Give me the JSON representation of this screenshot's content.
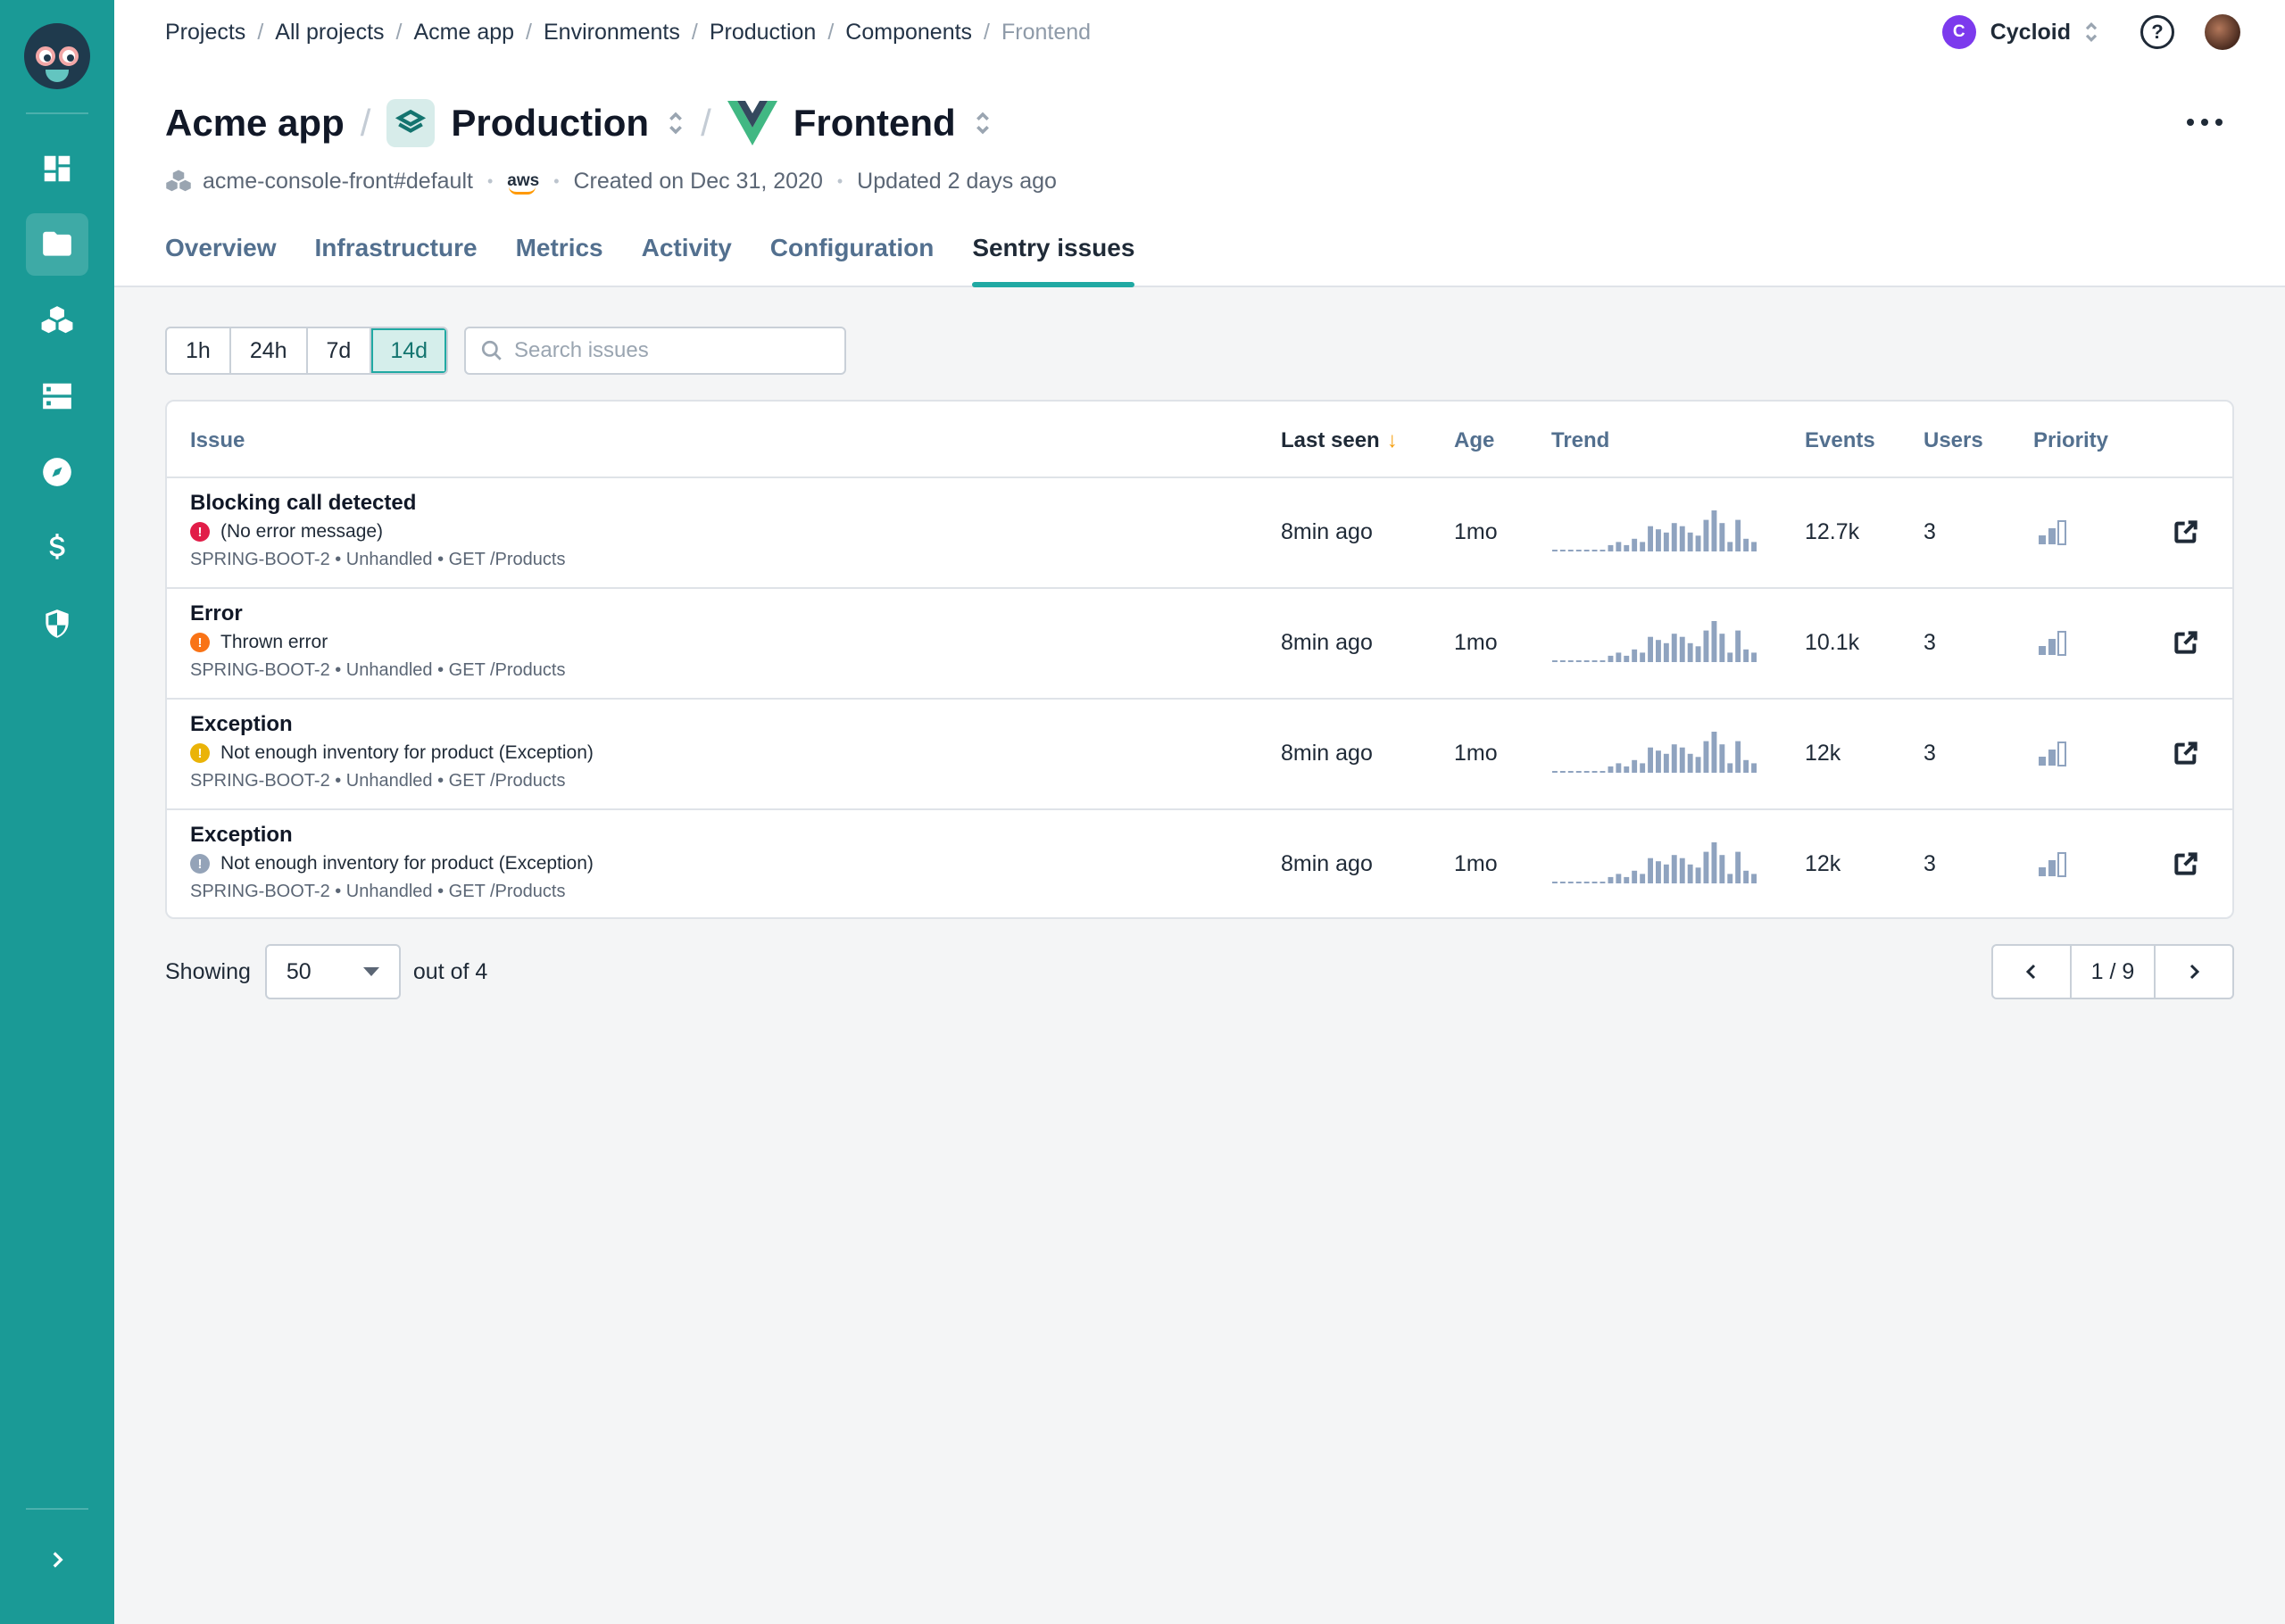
{
  "sidebar": {
    "items": [
      {
        "icon": "dashboard-icon",
        "active": false
      },
      {
        "icon": "folder-icon",
        "active": true
      },
      {
        "icon": "stacks-icon",
        "active": false
      },
      {
        "icon": "server-icon",
        "active": false
      },
      {
        "icon": "compass-icon",
        "active": false
      },
      {
        "icon": "dollar-icon",
        "active": false
      },
      {
        "icon": "shield-icon",
        "active": false
      }
    ]
  },
  "breadcrumb": [
    "Projects",
    "All projects",
    "Acme app",
    "Environments",
    "Production",
    "Components"
  ],
  "breadcrumb_current": "Frontend",
  "org": {
    "initial": "C",
    "name": "Cycloid",
    "color": "#7c3aed"
  },
  "title": {
    "project": "Acme app",
    "environment": "Production",
    "component": "Frontend"
  },
  "meta": {
    "stack": "acme-console-front#default",
    "cloud": "aws",
    "created": "Created on Dec 31, 2020",
    "updated": "Updated 2 days ago"
  },
  "tabs": [
    "Overview",
    "Infrastructure",
    "Metrics",
    "Activity",
    "Configuration",
    "Sentry issues"
  ],
  "active_tab": "Sentry issues",
  "time_ranges": [
    "1h",
    "24h",
    "7d",
    "14d"
  ],
  "active_range": "14d",
  "search": {
    "placeholder": "Search issues",
    "value": ""
  },
  "table": {
    "headers": {
      "issue": "Issue",
      "last_seen": "Last seen",
      "age": "Age",
      "trend": "Trend",
      "events": "Events",
      "users": "Users",
      "priority": "Priority"
    },
    "sorted_by": "Last seen",
    "rows": [
      {
        "title": "Blocking call detected",
        "status_color": "#e11d48",
        "message": "(No error message)",
        "meta": "SPRING-BOOT-2 • Unhandled • GET /Products",
        "last_seen": "8min ago",
        "age": "1mo",
        "events": "12.7k",
        "users": "3",
        "priority_level": 2,
        "trend": [
          1,
          1,
          1,
          1,
          1,
          1,
          1,
          2,
          3,
          2,
          4,
          3,
          8,
          7,
          6,
          9,
          8,
          6,
          5,
          10,
          13,
          9,
          3,
          10,
          4,
          3
        ]
      },
      {
        "title": "Error",
        "status_color": "#f97316",
        "message": "Thrown error",
        "meta": "SPRING-BOOT-2 • Unhandled • GET /Products",
        "last_seen": "8min ago",
        "age": "1mo",
        "events": "10.1k",
        "users": "3",
        "priority_level": 2,
        "trend": [
          1,
          1,
          1,
          1,
          1,
          1,
          1,
          2,
          3,
          2,
          4,
          3,
          8,
          7,
          6,
          9,
          8,
          6,
          5,
          10,
          13,
          9,
          3,
          10,
          4,
          3
        ]
      },
      {
        "title": "Exception",
        "status_color": "#eab308",
        "message": "Not enough inventory for product (Exception)",
        "meta": "SPRING-BOOT-2 • Unhandled • GET /Products",
        "last_seen": "8min ago",
        "age": "1mo",
        "events": "12k",
        "users": "3",
        "priority_level": 2,
        "trend": [
          1,
          1,
          1,
          1,
          1,
          1,
          1,
          2,
          3,
          2,
          4,
          3,
          8,
          7,
          6,
          9,
          8,
          6,
          5,
          10,
          13,
          9,
          3,
          10,
          4,
          3
        ]
      },
      {
        "title": "Exception",
        "status_color": "#94a3b8",
        "message": "Not enough inventory for product (Exception)",
        "meta": "SPRING-BOOT-2 • Unhandled • GET /Products",
        "last_seen": "8min ago",
        "age": "1mo",
        "events": "12k",
        "users": "3",
        "priority_level": 2,
        "trend": [
          1,
          1,
          1,
          1,
          1,
          1,
          1,
          2,
          3,
          2,
          4,
          3,
          8,
          7,
          6,
          9,
          8,
          6,
          5,
          10,
          13,
          9,
          3,
          10,
          4,
          3
        ]
      }
    ]
  },
  "footer": {
    "showing_label": "Showing",
    "page_size": "50",
    "out_of": "out of 4",
    "page_info": "1 / 9"
  }
}
